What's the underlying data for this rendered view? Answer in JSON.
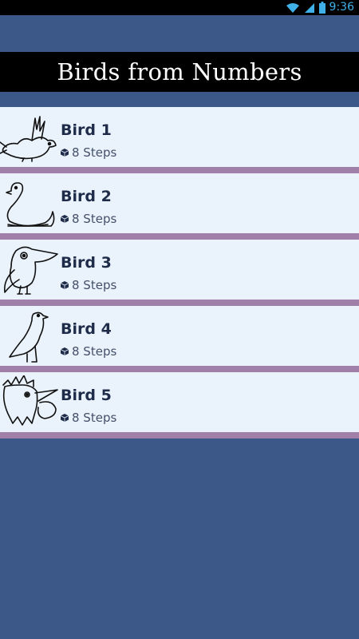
{
  "status_bar": {
    "time": "9:36",
    "icons": [
      "wifi-icon",
      "signal-icon",
      "battery-icon"
    ],
    "color": "#3fb0e8"
  },
  "header": {
    "title": "Birds from Numbers"
  },
  "list": {
    "items": [
      {
        "title": "Bird 1",
        "steps": "8 Steps",
        "thumbnail": "bird-1-drawing-icon"
      },
      {
        "title": "Bird 2",
        "steps": "8 Steps",
        "thumbnail": "bird-2-swan-drawing-icon"
      },
      {
        "title": "Bird 3",
        "steps": "8 Steps",
        "thumbnail": "bird-3-toucan-drawing-icon"
      },
      {
        "title": "Bird 4",
        "steps": "8 Steps",
        "thumbnail": "bird-4-pigeon-drawing-icon"
      },
      {
        "title": "Bird 5",
        "steps": "8 Steps",
        "thumbnail": "bird-5-rooster-drawing-icon"
      }
    ],
    "step_icon": "cube-icon"
  },
  "colors": {
    "background": "#3b5888",
    "title_bar": "#000000",
    "item_background": "#eaf2fb",
    "divider": "#a07fa8"
  }
}
